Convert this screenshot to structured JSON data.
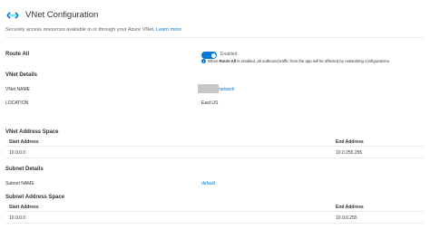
{
  "header": {
    "title": "VNet Configuration",
    "description": "Securely access resources available in or through your Azure VNet.",
    "learn_more": "Learn more"
  },
  "route_all": {
    "label": "Route All",
    "toggle_state": "Enabled",
    "info_prefix": "When",
    "info_bold": "Route All",
    "info_suffix": "is enabled, all outbound traffic from the app will be affected by networking configurations.",
    "accent": "#0078d4"
  },
  "vnet_details": {
    "section_title": "VNet Details",
    "name_label": "VNet NAME",
    "name_value": "network",
    "location_label": "LOCATION",
    "location_value": "East US"
  },
  "vnet_address_space": {
    "section_title": "VNet Address Space",
    "columns": [
      "Start Address",
      "End Address"
    ],
    "rows": [
      [
        "10.0.0.0",
        "10.0.255.255"
      ]
    ]
  },
  "subnet_details": {
    "section_title": "Subnet Details",
    "name_label": "Subnet NAME",
    "name_value": "default"
  },
  "subnet_address_space": {
    "section_title": "Subnet Address Space",
    "columns": [
      "Start Address",
      "End Address"
    ],
    "rows": [
      [
        "10.0.0.0",
        "10.0.0.255"
      ]
    ]
  }
}
